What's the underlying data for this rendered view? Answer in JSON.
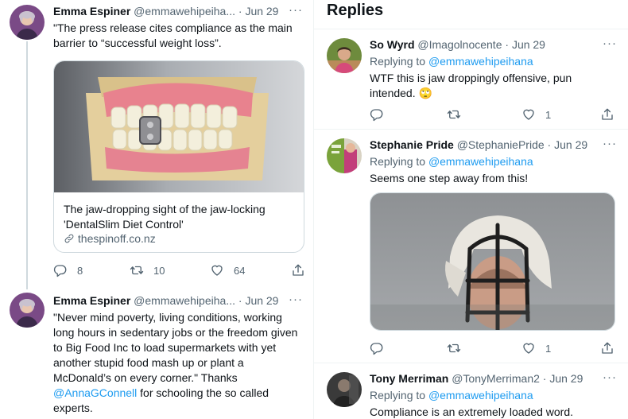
{
  "left_thread": [
    {
      "name": "Emma Espiner",
      "handle": "@emmawehipeiha...",
      "date": "Jun 29",
      "text": "\"The press release cites compliance as the main barrier to “successful weight loss”.",
      "card": {
        "title": "The jaw-dropping sight of the jaw-locking 'DentalSlim Diet Control'",
        "domain": "thespinoff.co.nz"
      },
      "replies": "8",
      "retweets": "10",
      "likes": "64"
    },
    {
      "name": "Emma Espiner",
      "handle": "@emmawehipeiha...",
      "date": "Jun 29",
      "text": "\"Never mind poverty, living conditions, working long hours in sedentary jobs or the freedom given to Big Food Inc to load supermarkets with yet another stupid food mash up or plant a McDonald’s on every corner.\" Thanks",
      "mention": "@AnnaGConnell",
      "text_after": " for schooling the so called experts."
    }
  ],
  "replies_section": {
    "title": "Replies",
    "items": [
      {
        "name": "So Wyrd",
        "handle": "@Imagolnocente",
        "date": "Jun 29",
        "replying_to_label": "Replying to",
        "replying_to": "@emmawehipeihana",
        "text": "WTF this is jaw droppingly offensive, pun intended. 🙄",
        "replies": "",
        "retweets": "",
        "likes": "1"
      },
      {
        "name": "Stephanie Pride",
        "handle": "@StephaniePride",
        "date": "Jun 29",
        "replying_to_label": "Replying to",
        "replying_to": "@emmawehipeihana",
        "text": "Seems one step away from this!",
        "replies": "",
        "retweets": "",
        "likes": "1"
      },
      {
        "name": "Tony Merriman",
        "handle": "@TonyMerriman2",
        "date": "Jun 29",
        "replying_to_label": "Replying to",
        "replying_to": "@emmawehipeihana",
        "text": "Compliance is an extremely loaded word."
      }
    ]
  },
  "separator_dot": "·",
  "more_glyph": "···",
  "icons": [
    "reply-icon",
    "retweet-icon",
    "like-icon",
    "share-icon",
    "link-icon",
    "more-icon"
  ],
  "colors": {
    "link": "#1d9bf0",
    "muted": "#536471",
    "border": "#cfd9de"
  }
}
